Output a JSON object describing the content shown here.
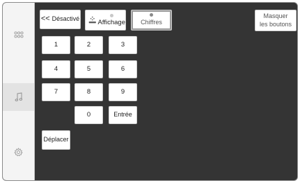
{
  "sidebar": {
    "items": [
      {
        "icon": "apps-grid-icon"
      },
      {
        "icon": "music-note-icon",
        "active": true
      },
      {
        "icon": "settings-gear-icon"
      }
    ]
  },
  "toolbar": {
    "back_label": "Désactivé",
    "display_label": "Affichage",
    "digits_label": "Chiffres",
    "hide_line1": "Masquer",
    "hide_line2": "les boutons"
  },
  "keypad": {
    "k1": "1",
    "k2": "2",
    "k3": "3",
    "k4": "4",
    "k5": "5",
    "k6": "6",
    "k7": "7",
    "k8": "8",
    "k9": "9",
    "k0": "0",
    "enter": "Entrée"
  },
  "move_label": "Déplacer"
}
